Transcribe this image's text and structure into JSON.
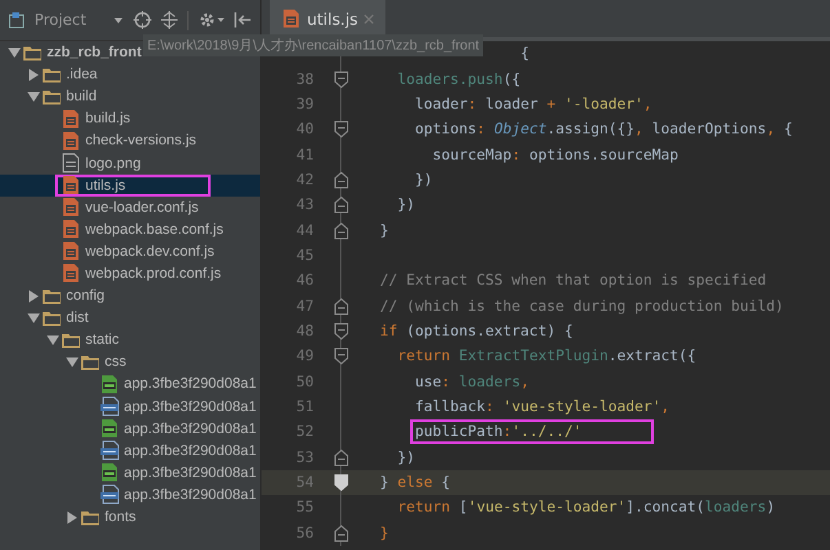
{
  "toolbar": {
    "title": "Project"
  },
  "tabs": [
    {
      "label": "utils.js",
      "kind": "js"
    }
  ],
  "tree": {
    "name": "zzb_rcb_front",
    "path": "E:\\work\\2018\\9月\\人才办\\rencaiban1107\\zzb_rcb_front",
    "kind": "folder",
    "expanded": true,
    "selected": false,
    "annotated": false,
    "children": [
      {
        "name": ".idea",
        "kind": "folder",
        "expanded": false,
        "selected": false,
        "annotated": false
      },
      {
        "name": "build",
        "kind": "folder",
        "expanded": true,
        "selected": false,
        "annotated": false,
        "children": [
          {
            "name": "build.js",
            "kind": "js",
            "selected": false,
            "annotated": false
          },
          {
            "name": "check-versions.js",
            "kind": "js",
            "selected": false,
            "annotated": false
          },
          {
            "name": "logo.png",
            "kind": "image",
            "selected": false,
            "annotated": false
          },
          {
            "name": "utils.js",
            "kind": "js",
            "selected": true,
            "annotated": true
          },
          {
            "name": "vue-loader.conf.js",
            "kind": "js",
            "selected": false,
            "annotated": false
          },
          {
            "name": "webpack.base.conf.js",
            "kind": "js",
            "selected": false,
            "annotated": false
          },
          {
            "name": "webpack.dev.conf.js",
            "kind": "js",
            "selected": false,
            "annotated": false
          },
          {
            "name": "webpack.prod.conf.js",
            "kind": "js",
            "selected": false,
            "annotated": false
          }
        ]
      },
      {
        "name": "config",
        "kind": "folder",
        "expanded": false,
        "selected": false,
        "annotated": false
      },
      {
        "name": "dist",
        "kind": "folder",
        "expanded": true,
        "selected": false,
        "annotated": false,
        "children": [
          {
            "name": "static",
            "kind": "folder",
            "expanded": true,
            "selected": false,
            "annotated": false,
            "children": [
              {
                "name": "css",
                "kind": "folder",
                "expanded": true,
                "selected": false,
                "annotated": false,
                "children": [
                  {
                    "name": "app.3fbe3f290d08a1",
                    "kind": "css",
                    "selected": false,
                    "annotated": false
                  },
                  {
                    "name": "app.3fbe3f290d08a1",
                    "kind": "data",
                    "selected": false,
                    "annotated": false
                  },
                  {
                    "name": "app.3fbe3f290d08a1",
                    "kind": "css",
                    "selected": false,
                    "annotated": false
                  },
                  {
                    "name": "app.3fbe3f290d08a1",
                    "kind": "data",
                    "selected": false,
                    "annotated": false
                  },
                  {
                    "name": "app.3fbe3f290d08a1",
                    "kind": "css",
                    "selected": false,
                    "annotated": false
                  },
                  {
                    "name": "app.3fbe3f290d08a1",
                    "kind": "data",
                    "selected": false,
                    "annotated": false
                  }
                ]
              },
              {
                "name": "fonts",
                "kind": "folder",
                "expanded": false,
                "selected": false,
                "annotated": false
              }
            ]
          }
        ]
      }
    ]
  },
  "editor": {
    "lines": [
      {
        "kind": "plain",
        "current": false,
        "boxed": false,
        "tokens": [
          {
            "kind": "plain",
            "text": "                {"
          }
        ]
      },
      {
        "number": "38",
        "kind": "fold_start",
        "current": false,
        "boxed": false,
        "tokens": [
          {
            "kind": "variable",
            "text": "  loaders.push"
          },
          {
            "kind": "plain",
            "text": "({"
          }
        ]
      },
      {
        "number": "39",
        "kind": "plain",
        "current": false,
        "boxed": false,
        "tokens": [
          {
            "kind": "plain",
            "text": "    loader"
          },
          {
            "kind": "punct",
            "text": ":"
          },
          {
            "kind": "plain",
            "text": " loader "
          },
          {
            "kind": "punct",
            "text": "+"
          },
          {
            "kind": "string",
            "text": " '-loader'"
          },
          {
            "kind": "punct",
            "text": ","
          }
        ]
      },
      {
        "number": "40",
        "kind": "fold_start",
        "current": false,
        "boxed": false,
        "tokens": [
          {
            "kind": "plain",
            "text": "    options"
          },
          {
            "kind": "punct",
            "text": ":"
          },
          {
            "kind": "type",
            "text": " Object"
          },
          {
            "kind": "plain",
            "text": ".assign({}"
          },
          {
            "kind": "punct",
            "text": ","
          },
          {
            "kind": "plain",
            "text": " loaderOptions"
          },
          {
            "kind": "punct",
            "text": ","
          },
          {
            "kind": "plain",
            "text": " {"
          }
        ]
      },
      {
        "number": "41",
        "kind": "plain",
        "current": false,
        "boxed": false,
        "tokens": [
          {
            "kind": "plain",
            "text": "      sourceMap"
          },
          {
            "kind": "punct",
            "text": ":"
          },
          {
            "kind": "plain",
            "text": " options.sourceMap"
          }
        ]
      },
      {
        "number": "42",
        "kind": "fold_end",
        "current": false,
        "boxed": false,
        "tokens": [
          {
            "kind": "plain",
            "text": "    })"
          }
        ]
      },
      {
        "number": "43",
        "kind": "fold_end",
        "current": false,
        "boxed": false,
        "tokens": [
          {
            "kind": "plain",
            "text": "  })"
          }
        ]
      },
      {
        "number": "44",
        "kind": "fold_end",
        "current": false,
        "boxed": false,
        "tokens": [
          {
            "kind": "plain",
            "text": "}"
          }
        ]
      },
      {
        "number": "45",
        "kind": "plain",
        "current": false
      },
      {
        "number": "46",
        "kind": "plain",
        "current": false,
        "boxed": false,
        "tokens": [
          {
            "kind": "comment",
            "text": "// Extract CSS when that option is specified"
          }
        ]
      },
      {
        "number": "47",
        "kind": "fold_end",
        "current": false,
        "boxed": false,
        "tokens": [
          {
            "kind": "comment",
            "text": "// (which is the case during production build)"
          }
        ]
      },
      {
        "number": "48",
        "kind": "fold_start",
        "current": false,
        "boxed": false,
        "tokens": [
          {
            "kind": "keyword",
            "text": "if"
          },
          {
            "kind": "plain",
            "text": " (options.extract) {"
          }
        ]
      },
      {
        "number": "49",
        "kind": "fold_start",
        "current": false,
        "boxed": false,
        "tokens": [
          {
            "kind": "keyword",
            "text": "  return"
          },
          {
            "kind": "variable",
            "text": " ExtractTextPlugin"
          },
          {
            "kind": "plain",
            "text": ".extract({"
          }
        ]
      },
      {
        "number": "50",
        "kind": "plain",
        "current": false,
        "boxed": false,
        "tokens": [
          {
            "kind": "plain",
            "text": "    use"
          },
          {
            "kind": "punct",
            "text": ":"
          },
          {
            "kind": "variable",
            "text": " loaders"
          },
          {
            "kind": "punct",
            "text": ","
          }
        ]
      },
      {
        "number": "51",
        "kind": "plain",
        "current": false,
        "boxed": false,
        "tokens": [
          {
            "kind": "plain",
            "text": "    fallback"
          },
          {
            "kind": "punct",
            "text": ":"
          },
          {
            "kind": "string",
            "text": " 'vue-style-loader'"
          },
          {
            "kind": "punct",
            "text": ","
          }
        ]
      },
      {
        "number": "52",
        "kind": "plain",
        "current": false,
        "boxed": true,
        "tokens": [
          {
            "kind": "plain",
            "text": "    publicPath"
          },
          {
            "kind": "punct",
            "text": ":"
          },
          {
            "kind": "string",
            "text": "'../../'"
          }
        ]
      },
      {
        "number": "53",
        "kind": "fold_end",
        "current": false,
        "boxed": false,
        "tokens": [
          {
            "kind": "plain",
            "text": "  })"
          }
        ]
      },
      {
        "number": "54",
        "kind": "bookmark",
        "current": true,
        "boxed": false,
        "tokens": [
          {
            "kind": "plain",
            "text": "} "
          },
          {
            "kind": "keyword",
            "text": "else"
          },
          {
            "kind": "plain",
            "text": " {"
          }
        ]
      },
      {
        "number": "55",
        "kind": "plain",
        "current": false,
        "boxed": false,
        "tokens": [
          {
            "kind": "keyword",
            "text": "  return"
          },
          {
            "kind": "plain",
            "text": " ["
          },
          {
            "kind": "string",
            "text": "'vue-style-loader'"
          },
          {
            "kind": "plain",
            "text": "].concat("
          },
          {
            "kind": "variable",
            "text": "loaders"
          },
          {
            "kind": "plain",
            "text": ")"
          }
        ]
      },
      {
        "number": "56",
        "kind": "fold_end",
        "current": false,
        "boxed": false,
        "tokens": [
          {
            "kind": "keyword",
            "text": "}"
          }
        ]
      }
    ]
  }
}
